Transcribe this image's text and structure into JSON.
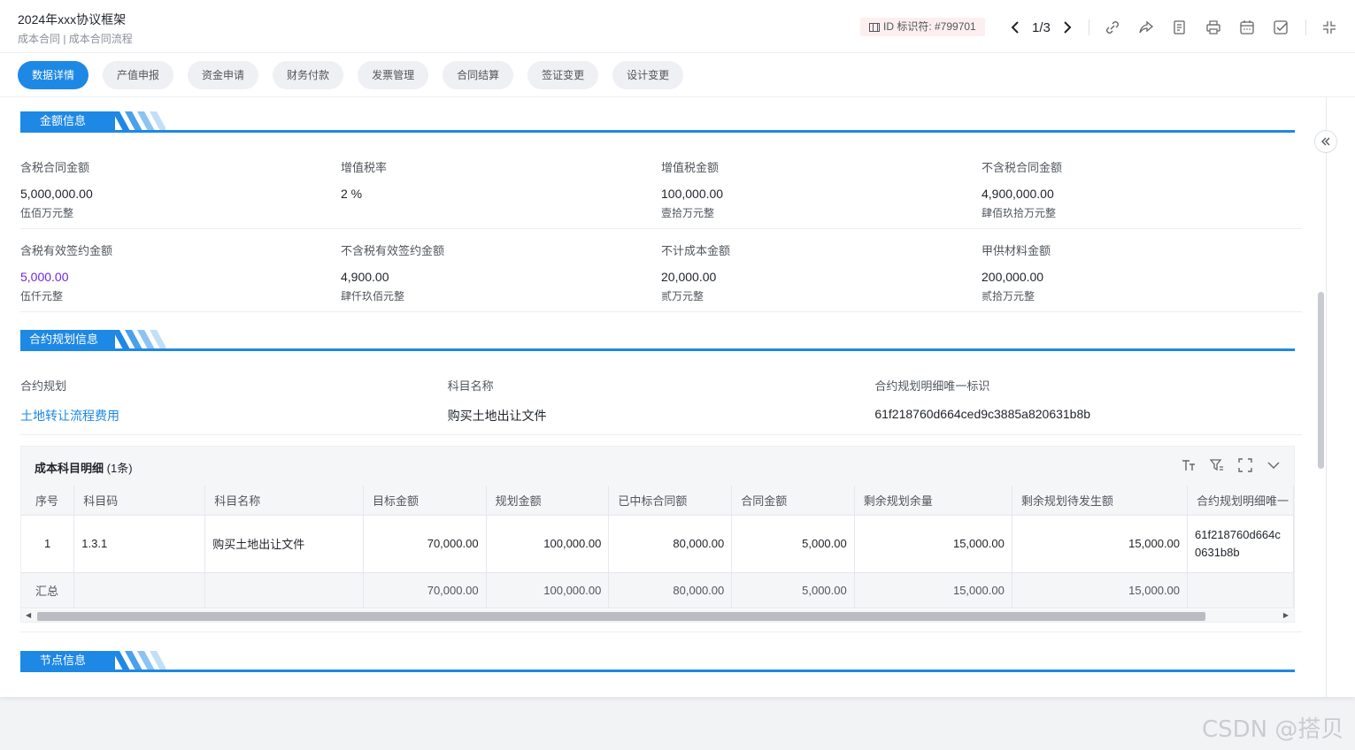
{
  "header": {
    "title": "2024年xxx协议框架",
    "breadcrumb": "成本合同 | 成本合同流程",
    "id_label": "ID  标识符: #799701",
    "page_indicator": "1/3"
  },
  "tabs": [
    {
      "label": "数据详情",
      "active": true
    },
    {
      "label": "产值申报"
    },
    {
      "label": "资金申请"
    },
    {
      "label": "财务付款"
    },
    {
      "label": "发票管理"
    },
    {
      "label": "合同结算"
    },
    {
      "label": "签证变更"
    },
    {
      "label": "设计变更"
    }
  ],
  "amount_section": {
    "title": "金额信息",
    "rows": [
      [
        {
          "label": "含税合同金额",
          "value": "5,000,000.00",
          "upper": "伍佰万元整"
        },
        {
          "label": "增值税率",
          "value": "2 %",
          "upper": ""
        },
        {
          "label": "增值税金额",
          "value": "100,000.00",
          "upper": "壹拾万元整"
        },
        {
          "label": "不含税合同金额",
          "value": "4,900,000.00",
          "upper": "肆佰玖拾万元整"
        }
      ],
      [
        {
          "label": "含税有效签约金额",
          "value": "5,000.00",
          "upper": "伍仟元整"
        },
        {
          "label": "不含税有效签约金额",
          "value": "4,900.00",
          "upper": "肆仟玖佰元整"
        },
        {
          "label": "不计成本金额",
          "value": "20,000.00",
          "upper": "贰万元整"
        },
        {
          "label": "甲供材料金额",
          "value": "200,000.00",
          "upper": "贰拾万元整"
        }
      ]
    ]
  },
  "plan_section": {
    "title": "合约规划信息",
    "fields": [
      {
        "label": "合约规划",
        "value": "土地转让流程费用"
      },
      {
        "label": "科目名称",
        "value": "购买土地出让文件"
      },
      {
        "label": "合约规划明细唯一标识",
        "value": "61f218760d664ced9c3885a820631b8b"
      }
    ]
  },
  "cost_table": {
    "title": "成本科目明细",
    "count": "(1条)",
    "columns": [
      "序号",
      "科目码",
      "科目名称",
      "目标金额",
      "规划金额",
      "已中标合同额",
      "合同金额",
      "剩余规划余量",
      "剩余规划待发生额",
      "合约规划明细唯一"
    ],
    "rows": [
      [
        "1",
        "1.3.1",
        "购买土地出让文件",
        "70,000.00",
        "100,000.00",
        "80,000.00",
        "5,000.00",
        "15,000.00",
        "15,000.00",
        "61f218760d664c 0631b8b"
      ]
    ],
    "summary": [
      "汇总",
      "",
      "",
      "70,000.00",
      "100,000.00",
      "80,000.00",
      "5,000.00",
      "15,000.00",
      "15,000.00",
      ""
    ]
  },
  "node_section": {
    "title": "节点信息"
  },
  "watermark": "CSDN @搭贝",
  "colors": {
    "accent": "#1e88e5",
    "purple": "#6d28d9"
  }
}
